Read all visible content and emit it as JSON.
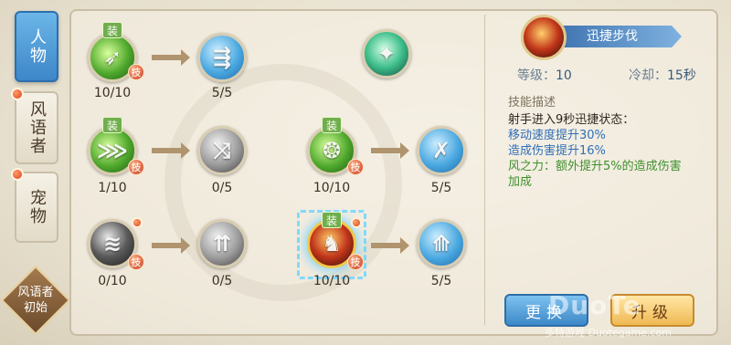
{
  "tabs": [
    {
      "label": "人物",
      "active": true
    },
    {
      "label": "风语者",
      "active": false
    },
    {
      "label": "宠物",
      "active": false
    }
  ],
  "class_badge": {
    "line1": "风语者",
    "line2": "初始"
  },
  "equip_label": "装",
  "skill_tag": "技",
  "skills": {
    "r1c1": {
      "level": "10/10",
      "icon": "wind-arrow-burst-icon"
    },
    "r1c2": {
      "level": "5/5",
      "icon": "twin-arrows-icon"
    },
    "r1c4": {
      "icon": "jade-wind-slash-icon"
    },
    "r2c1": {
      "level": "1/10",
      "icon": "volley-arrows-icon"
    },
    "r2c2": {
      "level": "0/5",
      "icon": "split-arrows-icon"
    },
    "r2c3": {
      "level": "10/10",
      "icon": "gale-orb-icon"
    },
    "r2c4": {
      "level": "5/5",
      "icon": "crossed-bolts-icon"
    },
    "r3c1": {
      "level": "0/10",
      "icon": "shadow-claw-icon"
    },
    "r3c2": {
      "level": "0/5",
      "icon": "trident-arrows-icon"
    },
    "r3c3": {
      "level": "10/10",
      "icon": "swift-step-icon"
    },
    "r3c4": {
      "level": "5/5",
      "icon": "winged-boot-icon"
    }
  },
  "detail": {
    "name": "迅捷步伐",
    "level_label": "等级：",
    "level_value": "10",
    "cooldown_label": "冷却：",
    "cooldown_value": "15秒",
    "desc_title": "技能描述",
    "desc_line1": "射手进入9秒迅捷状态：",
    "desc_line2": "移动速度提升30%",
    "desc_line3": "造成伤害提升16%",
    "desc_line4": "风之力：额外提升5%的造成伤害",
    "desc_line5": "加成"
  },
  "buttons": {
    "change": "更换",
    "upgrade": "升级"
  },
  "watermark": {
    "main": "DuoTe",
    "sub": "多特游戏 Duotegame.com"
  },
  "colors": {
    "accent_blue": "#3d86c8",
    "gold": "#f0b953",
    "green_text": "#3f8f2e",
    "blue_text": "#2f6fb8"
  }
}
